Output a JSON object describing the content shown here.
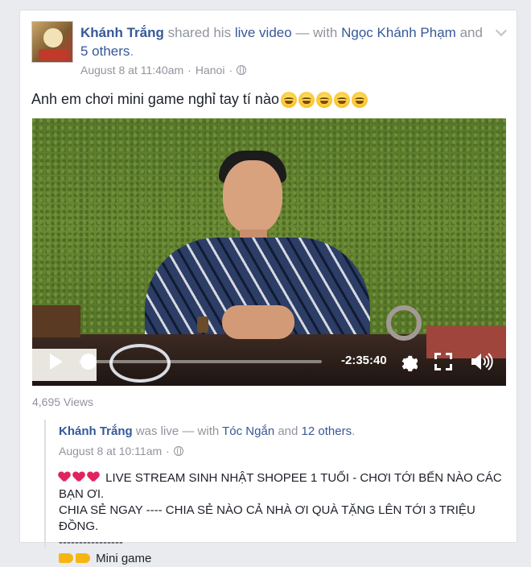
{
  "post": {
    "author": "Khánh Trắng",
    "action_text": "shared his",
    "action_link": "live video",
    "with_text": "— with",
    "tagged_person": "Ngọc Khánh Phạm",
    "and_text": "and",
    "others_link": "5 others",
    "period": ".",
    "timestamp": "August 8 at 11:40am",
    "separator": "·",
    "location": "Hanoi",
    "separator2": "·",
    "text": "Anh em chơi mini game nghỉ tay tí nào"
  },
  "video": {
    "time_remaining": "-2:35:40",
    "progress": 0.03
  },
  "views": "4,695 Views",
  "shared_post": {
    "author": "Khánh Trắng",
    "was_live": "was live",
    "with_text": "— with",
    "tagged_person": "Tóc Ngắn",
    "and_text": "and",
    "others_link": "12 others",
    "period": ".",
    "timestamp": "August 8 at 10:11am",
    "separator": "·",
    "line1": "LIVE STREAM SINH NHẬT SHOPEE 1 TUỔI - CHƠI TỚI BẾN NÀO CÁC BẠN ƠI.",
    "line2": "CHIA SẺ NGAY ---- CHIA SẺ NÀO CẢ NHÀ ƠI QUÀ TẶNG LÊN TỚI 3 TRIỆU ĐỒNG.",
    "line3": "----------------",
    "line4": "Mini game"
  }
}
